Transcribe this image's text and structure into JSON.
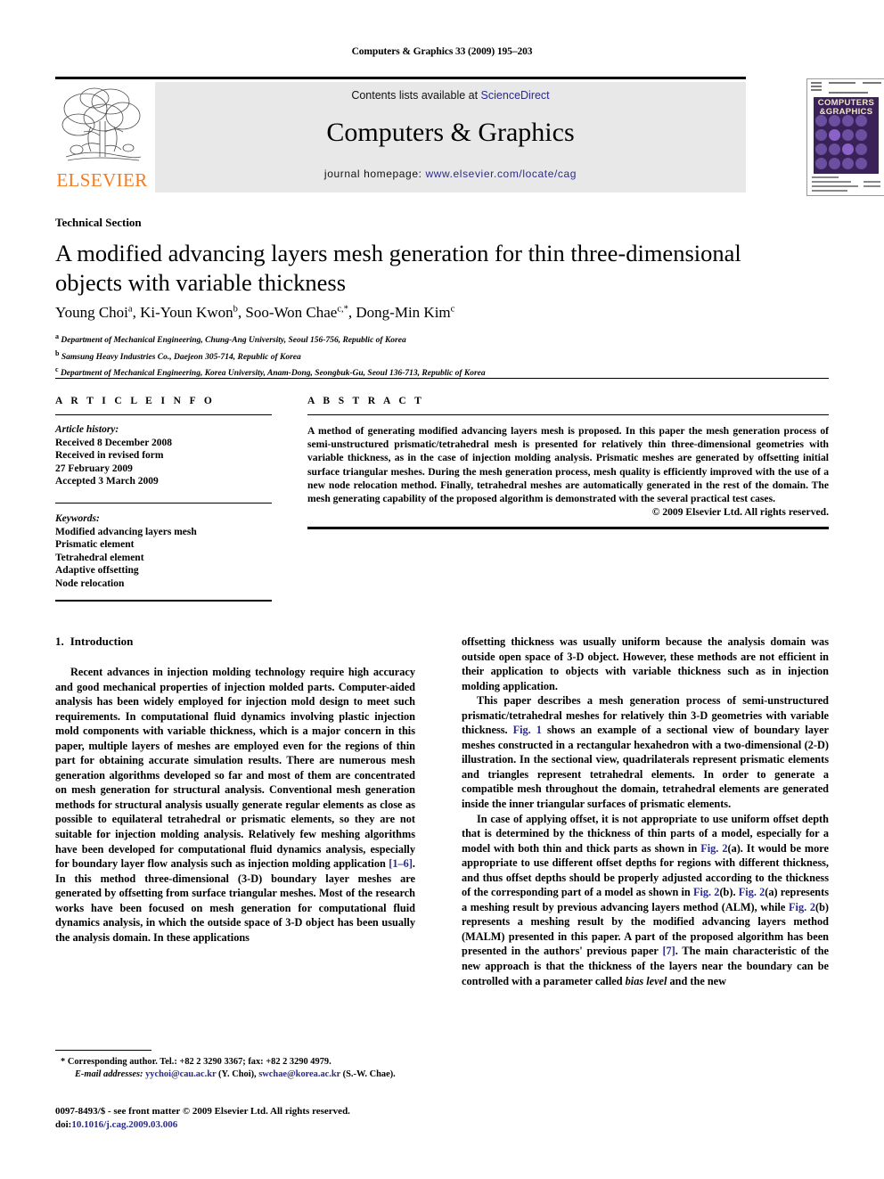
{
  "running_head": "Computers & Graphics 33 (2009) 195–203",
  "masthead": {
    "publisher": "ELSEVIER",
    "contents_line": "Contents lists available at ",
    "sciencedirect": "ScienceDirect",
    "journal_title": "Computers & Graphics",
    "homepage_label": "journal homepage: ",
    "homepage_url": "www.elsevier.com/locate/cag",
    "cover": {
      "title_line1": "COMPUTERS",
      "title_line2": "&GRAPHICS"
    },
    "colors": {
      "elsevier_orange": "#F47B20",
      "link_blue": "#2a2a8c",
      "banner_gray": "#e8e8e8",
      "cover_purple": "#3a2258"
    }
  },
  "article": {
    "section_label": "Technical Section",
    "title": "A modified advancing layers mesh generation for thin three-dimensional objects with variable thickness",
    "authors": [
      {
        "name": "Young Choi",
        "sup": "a"
      },
      {
        "name": "Ki-Youn Kwon",
        "sup": "b"
      },
      {
        "name": "Soo-Won Chae",
        "sup": "c,*"
      },
      {
        "name": "Dong-Min Kim",
        "sup": "c"
      }
    ],
    "affiliations": [
      {
        "sup": "a",
        "text": "Department of Mechanical Engineering, Chung-Ang University, Seoul 156-756, Republic of Korea"
      },
      {
        "sup": "b",
        "text": "Samsung Heavy Industries Co., Daejeon 305-714, Republic of Korea"
      },
      {
        "sup": "c",
        "text": "Department of Mechanical Engineering, Korea University, Anam-Dong, Seongbuk-Gu, Seoul 136-713, Republic of Korea"
      }
    ]
  },
  "info": {
    "heading": "A R T I C L E  I N F O",
    "history_label": "Article history:",
    "history_lines": [
      "Received 8 December 2008",
      "Received in revised form",
      "27 February 2009",
      "Accepted 3 March 2009"
    ],
    "keywords_label": "Keywords:",
    "keywords": [
      "Modified advancing layers mesh",
      "Prismatic element",
      "Tetrahedral element",
      "Adaptive offsetting",
      "Node relocation"
    ]
  },
  "abstract": {
    "heading": "A B S T R A C T",
    "text": "A method of generating modified advancing layers mesh is proposed. In this paper the mesh generation process of semi-unstructured prismatic/tetrahedral mesh is presented for relatively thin three-dimensional geometries with variable thickness, as in the case of injection molding analysis. Prismatic meshes are generated by offsetting initial surface triangular meshes. During the mesh generation process, mesh quality is efficiently improved with the use of a new node relocation method. Finally, tetrahedral meshes are automatically generated in the rest of the domain. The mesh generating capability of the proposed algorithm is demonstrated with the several practical test cases.",
    "copyright": "© 2009 Elsevier Ltd. All rights reserved."
  },
  "body": {
    "section_number": "1.",
    "section_title": "Introduction",
    "left_para_1_a": "Recent advances in injection molding technology require high accuracy and good mechanical properties of injection molded parts. Computer-aided analysis has been widely employed for injection mold design to meet such requirements. In computational fluid dynamics involving plastic injection mold components with variable thickness, which is a major concern in this paper, multiple layers of meshes are employed even for the regions of thin part for obtaining accurate simulation results. There are numerous mesh generation algorithms developed so far and most of them are concentrated on mesh generation for structural analysis. Conventional mesh generation methods for structural analysis usually generate regular elements as close as possible to equilateral tetrahedral or prismatic elements, so they are not suitable for injection molding analysis. Relatively few meshing algorithms have been developed for computational fluid dynamics analysis, especially for boundary layer flow analysis such as injection molding application ",
    "left_ref_1": "[1–6]",
    "left_para_1_b": ". In this method three-dimensional (3-D) boundary layer meshes are generated by offsetting from surface triangular meshes. Most of the research works have been focused on mesh generation for computational fluid dynamics analysis, in which the outside space of 3-D object has been usually the analysis domain. In these applications",
    "right_para_1": "offsetting thickness was usually uniform because the analysis domain was outside open space of 3-D object. However, these methods are not efficient in their application to objects with variable thickness such as in injection molding application.",
    "right_para_2_a": "This paper describes a mesh generation process of semi-unstructured prismatic/tetrahedral meshes for relatively thin 3-D geometries with variable thickness. ",
    "right_ref_fig1": "Fig. 1",
    "right_para_2_b": " shows an example of a sectional view of boundary layer meshes constructed in a rectangular hexahedron with a two-dimensional (2-D) illustration. In the sectional view, quadrilaterals represent prismatic elements and triangles represent tetrahedral elements. In order to generate a compatible mesh throughout the domain, tetrahedral elements are generated inside the inner triangular surfaces of prismatic elements.",
    "right_para_3_a": "In case of applying offset, it is not appropriate to use uniform offset depth that is determined by the thickness of thin parts of a model, especially for a model with both thin and thick parts as shown in ",
    "right_ref_fig2a_1": "Fig. 2",
    "right_para_3_b": "(a). It would be more appropriate to use different offset depths for regions with different thickness, and thus offset depths should be properly adjusted according to the thickness of the corresponding part of a model as shown in ",
    "right_ref_fig2b": "Fig. 2",
    "right_para_3_c": "(b). ",
    "right_ref_fig2a_2": "Fig. 2",
    "right_para_3_d": "(a) represents a meshing result by previous advancing layers method (ALM), while ",
    "right_ref_fig2b_2": "Fig. 2",
    "right_para_3_e": "(b) represents a meshing result by the modified advancing layers method (MALM) presented in this paper. A part of the proposed algorithm has been presented in the authors' previous paper ",
    "right_ref_7": "[7]",
    "right_para_3_f": ". The main characteristic of the new approach is that the thickness of the layers near the boundary can be controlled with a parameter called ",
    "right_italic_bias": "bias level",
    "right_para_3_g": " and the new"
  },
  "footnote": {
    "marker": "*",
    "corresponding": "Corresponding author. Tel.: +82 2 3290 3367; fax: +82 2 3290 4979.",
    "email_label": "E-mail addresses:",
    "email_1": "yychoi@cau.ac.kr",
    "email_1_name": " (Y. Choi), ",
    "email_2": "swchae@korea.ac.kr",
    "email_2_name": " (S.-W. Chae)."
  },
  "imprint": {
    "line1": "0097-8493/$ - see front matter © 2009 Elsevier Ltd. All rights reserved.",
    "doi_label": "doi:",
    "doi_value": "10.1016/j.cag.2009.03.006"
  }
}
